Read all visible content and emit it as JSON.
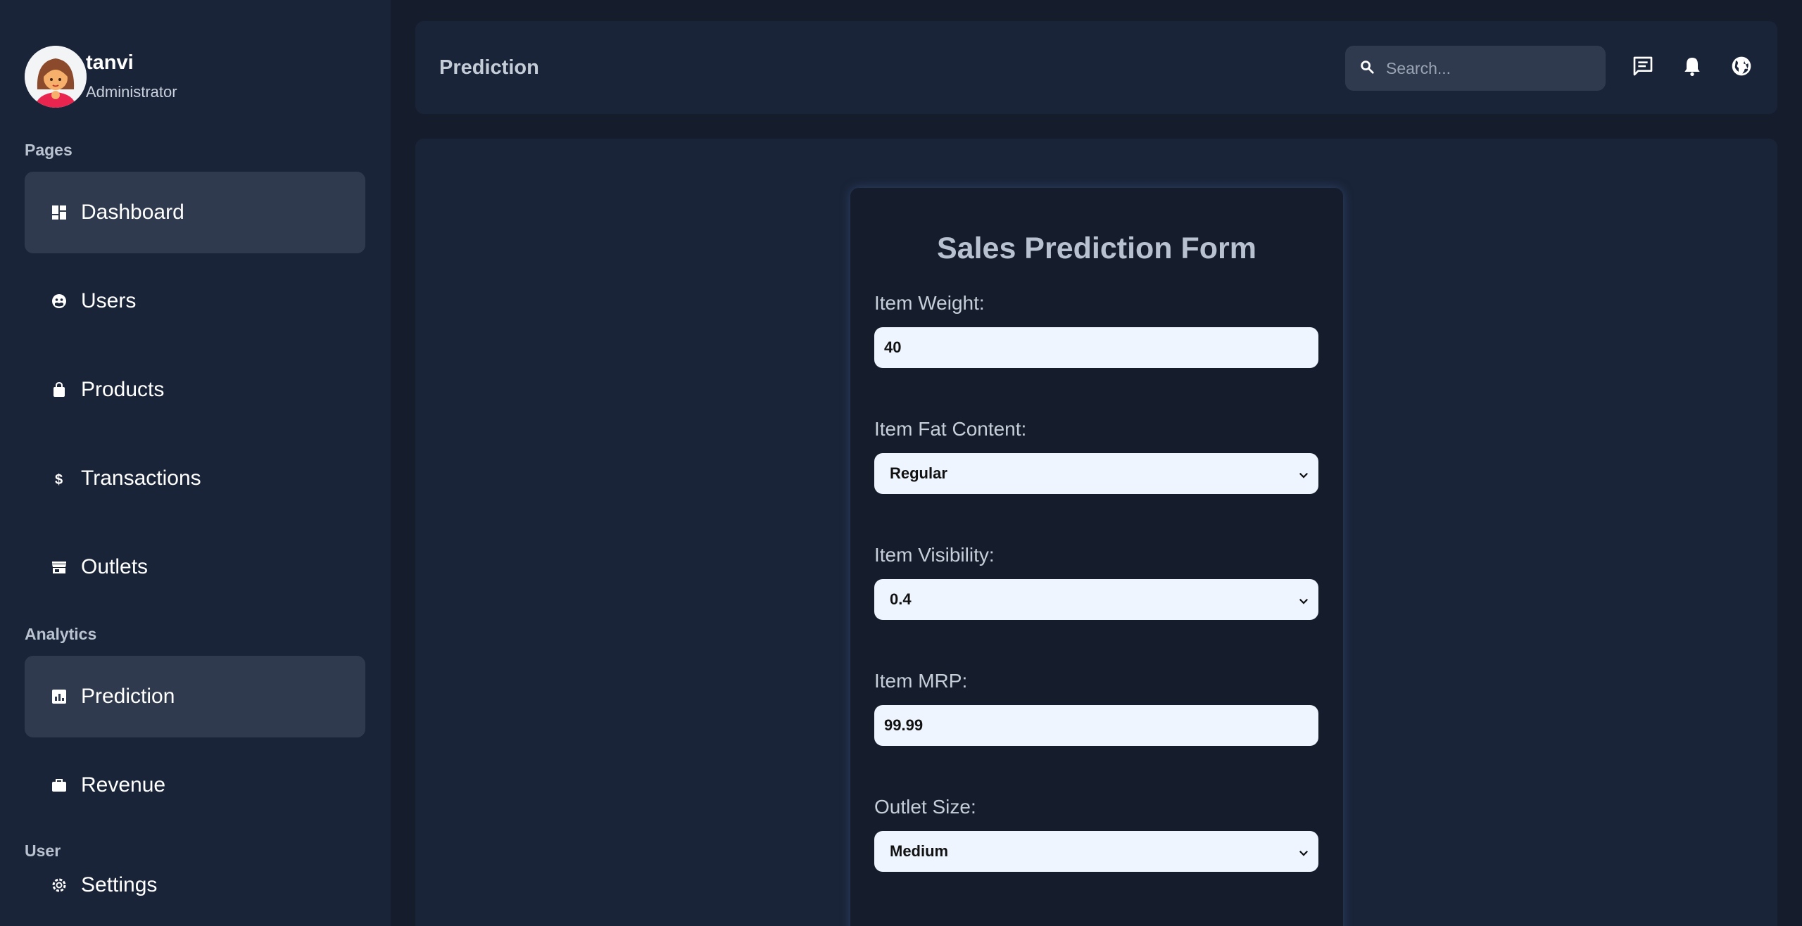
{
  "profile": {
    "name": "tanvi",
    "role": "Administrator"
  },
  "sidebar": {
    "sections": [
      "Pages",
      "Analytics",
      "User"
    ],
    "items": [
      {
        "label": "Dashboard",
        "icon": "dashboard-icon",
        "active": true
      },
      {
        "label": "Users",
        "icon": "users-icon",
        "active": false
      },
      {
        "label": "Products",
        "icon": "shopping-bag-icon",
        "active": false
      },
      {
        "label": "Transactions",
        "icon": "dollar-icon",
        "active": false
      },
      {
        "label": "Outlets",
        "icon": "store-icon",
        "active": false
      },
      {
        "label": "Prediction",
        "icon": "chart-icon",
        "active": true
      },
      {
        "label": "Revenue",
        "icon": "briefcase-icon",
        "active": false
      },
      {
        "label": "Settings",
        "icon": "gear-icon",
        "active": false
      }
    ]
  },
  "header": {
    "title": "Prediction",
    "search_placeholder": "Search...",
    "icons": [
      "chat-icon",
      "bell-icon",
      "globe-icon"
    ]
  },
  "form": {
    "title": "Sales Prediction Form",
    "fields": [
      {
        "label": "Item Weight:",
        "value": "40",
        "type": "input"
      },
      {
        "label": "Item Fat Content:",
        "value": "Regular",
        "type": "select"
      },
      {
        "label": "Item Visibility:",
        "value": "0.4",
        "type": "select"
      },
      {
        "label": "Item MRP:",
        "value": "99.99",
        "type": "input"
      },
      {
        "label": "Outlet Size:",
        "value": "Medium",
        "type": "select"
      }
    ]
  },
  "colors": {
    "background": "#151c2c",
    "panel": "#1a2438",
    "active_item": "#2f3a4f",
    "field": "#eef5ff"
  }
}
